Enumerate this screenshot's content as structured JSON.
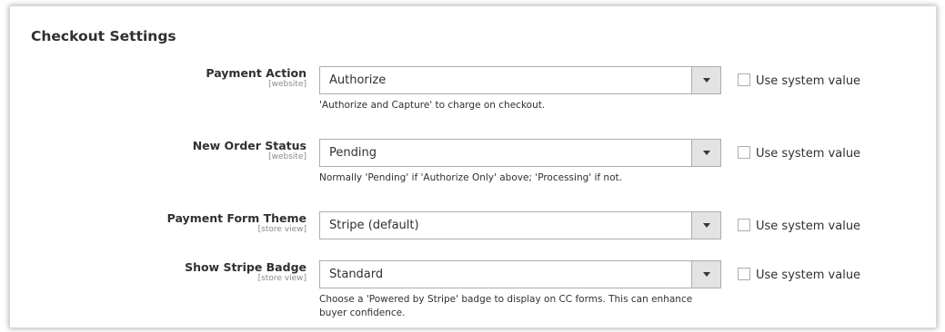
{
  "section": {
    "title": "Checkout Settings"
  },
  "fields": [
    {
      "label": "Payment Action",
      "scope": "[website]",
      "value": "Authorize",
      "system_value_label": "Use system value",
      "note": "'Authorize and Capture' to charge on checkout."
    },
    {
      "label": "New Order Status",
      "scope": "[website]",
      "value": "Pending",
      "system_value_label": "Use system value",
      "note": "Normally 'Pending' if 'Authorize Only' above; 'Processing' if not."
    },
    {
      "label": "Payment Form Theme",
      "scope": "[store view]",
      "value": "Stripe (default)",
      "system_value_label": "Use system value",
      "note": ""
    },
    {
      "label": "Show Stripe Badge",
      "scope": "[store view]",
      "value": "Standard",
      "system_value_label": "Use system value",
      "note": "Choose a 'Powered by Stripe' badge to display on CC forms. This can enhance buyer confidence."
    }
  ]
}
